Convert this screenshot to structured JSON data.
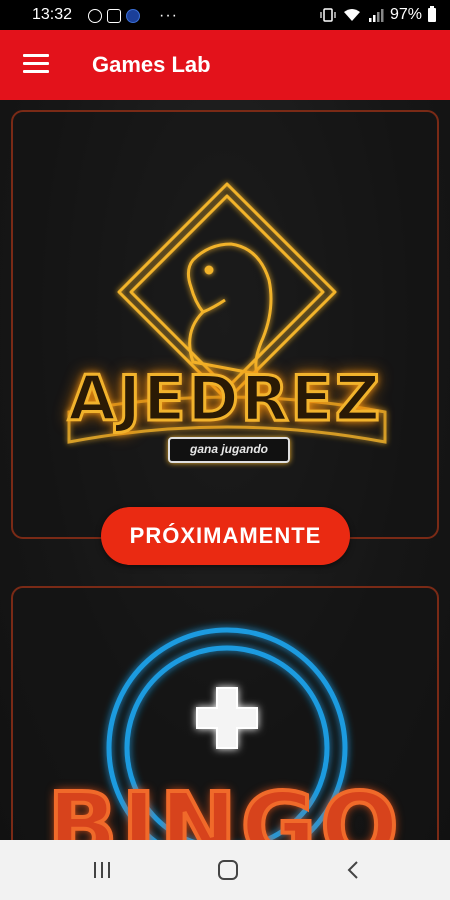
{
  "status_bar": {
    "time": "13:32",
    "battery": "97%",
    "overflow": "···",
    "icons": [
      "whatsapp-icon",
      "flipboard-icon",
      "app-notification-icon",
      "vibrate-icon",
      "wifi-icon",
      "signal-icon",
      "battery-icon"
    ]
  },
  "app_bar": {
    "title": "Games Lab",
    "menu_icon": "hamburger-menu-icon"
  },
  "cards": [
    {
      "title": "AJEDREZ",
      "subtitle": "gana jugando",
      "button_label": "PRÓXIMAMENTE",
      "colors": {
        "neon": "#f2b32c",
        "button": "#ea2a12"
      }
    },
    {
      "title": "BINGO",
      "colors": {
        "neon_ring": "#1e9be0",
        "title": "#e0461c"
      }
    }
  ],
  "nav_bar": {
    "recents_icon": "recents-icon",
    "home_icon": "home-icon",
    "back_icon": "back-icon"
  },
  "colors": {
    "appbar": "#e3121b",
    "background": "#151515",
    "card_border": "#7a2a16"
  }
}
